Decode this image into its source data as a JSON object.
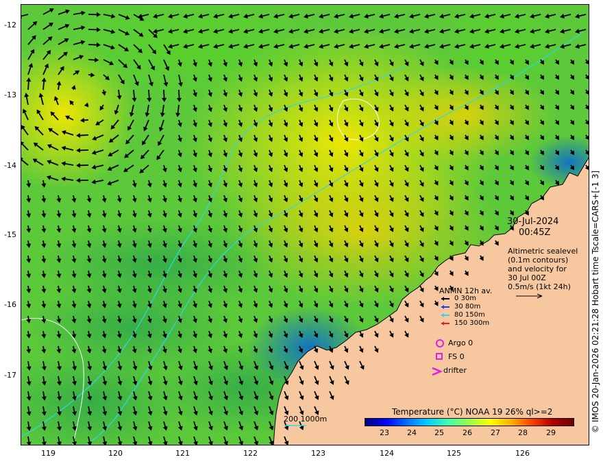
{
  "map": {
    "lat_labels": [
      "-12",
      "-13",
      "-14",
      "-15",
      "-16",
      "-17"
    ],
    "lon_labels": [
      "119",
      "120",
      "121",
      "122",
      "123",
      "124",
      "125",
      "126"
    ],
    "date": "30-Jul-2024",
    "time": "00:45Z",
    "info_lines": [
      "Altimetric sealevel",
      "(0.1m contours)",
      "and velocity for",
      "30 Jul 00Z",
      "0.5m/s (1kt 24h)"
    ],
    "anmn": {
      "title": "ANMN 12h av.",
      "items": [
        {
          "label": "0 30m",
          "color": "#000000"
        },
        {
          "label": "30 80m",
          "color": "#1a3cff"
        },
        {
          "label": "80 150m",
          "color": "#30d6e8"
        },
        {
          "label": "150 300m",
          "color": "#e8201a"
        }
      ]
    },
    "markers": {
      "argo": "Argo 0",
      "fs": "FS 0",
      "drifter": "drifter"
    },
    "depth_contours": "200  1000m",
    "colorbar": {
      "title": "Temperature (°C) NOAA 19 26% ql>=2",
      "ticks": [
        "23",
        "24",
        "25",
        "26",
        "27",
        "28",
        "29"
      ]
    },
    "copyright": "© IMOS 20-Jan-2026 02:21:28 Hobart time Tscale=CARS+[-1 3]",
    "colors": {
      "land": "#f7c8a0",
      "marker": "#e020e0",
      "contour": "#30d6e8"
    }
  }
}
